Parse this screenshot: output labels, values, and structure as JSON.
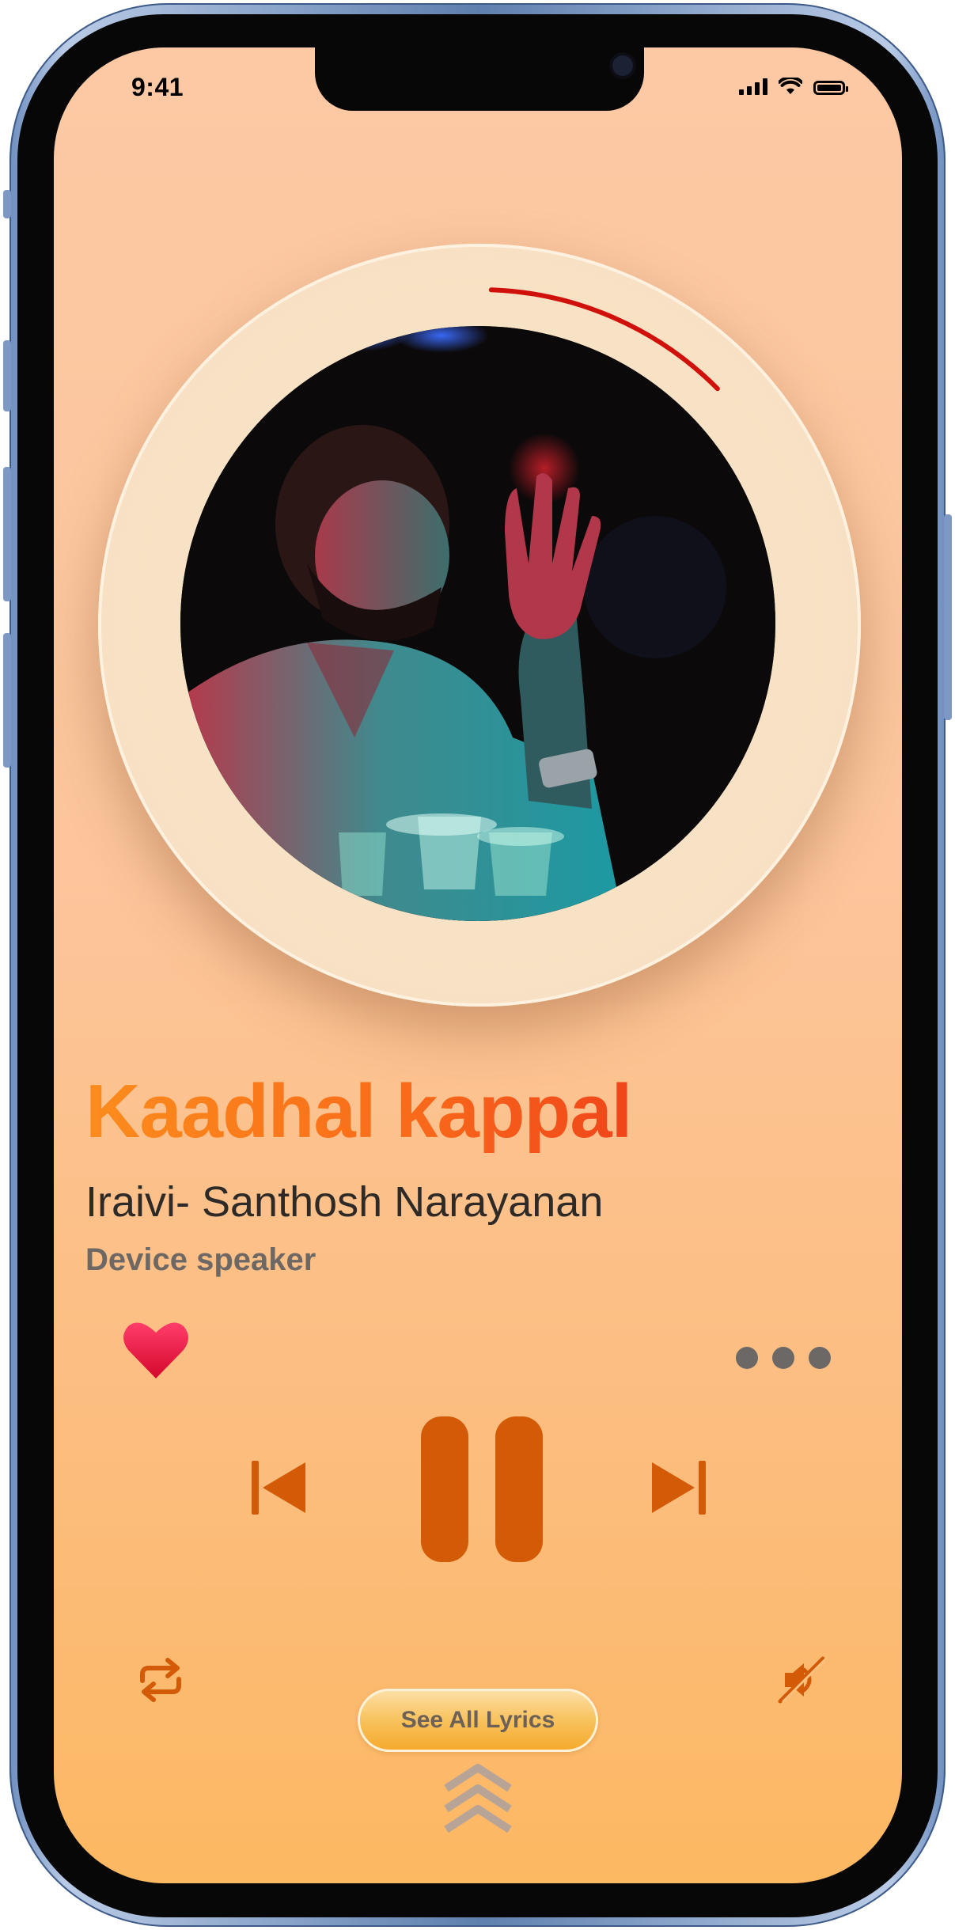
{
  "status_bar": {
    "time": "9:41"
  },
  "now_playing": {
    "title": "Kaadhal kappal",
    "artist": "Iraivi- Santhosh Narayanan",
    "output_device": "Device speaker",
    "progress_fraction": 0.12,
    "liked": true
  },
  "controls": {
    "lyrics_button_label": "See All Lyrics"
  },
  "colors": {
    "accent": "#d35a06",
    "heart": "#e8153a",
    "progress": "#d0100a"
  },
  "icons": {
    "like": "heart-icon",
    "more": "more-dots-icon",
    "previous": "previous-icon",
    "pause": "pause-icon",
    "next": "next-icon",
    "repeat": "repeat-icon",
    "mute": "mute-icon",
    "expand": "chevron-up-icon"
  }
}
